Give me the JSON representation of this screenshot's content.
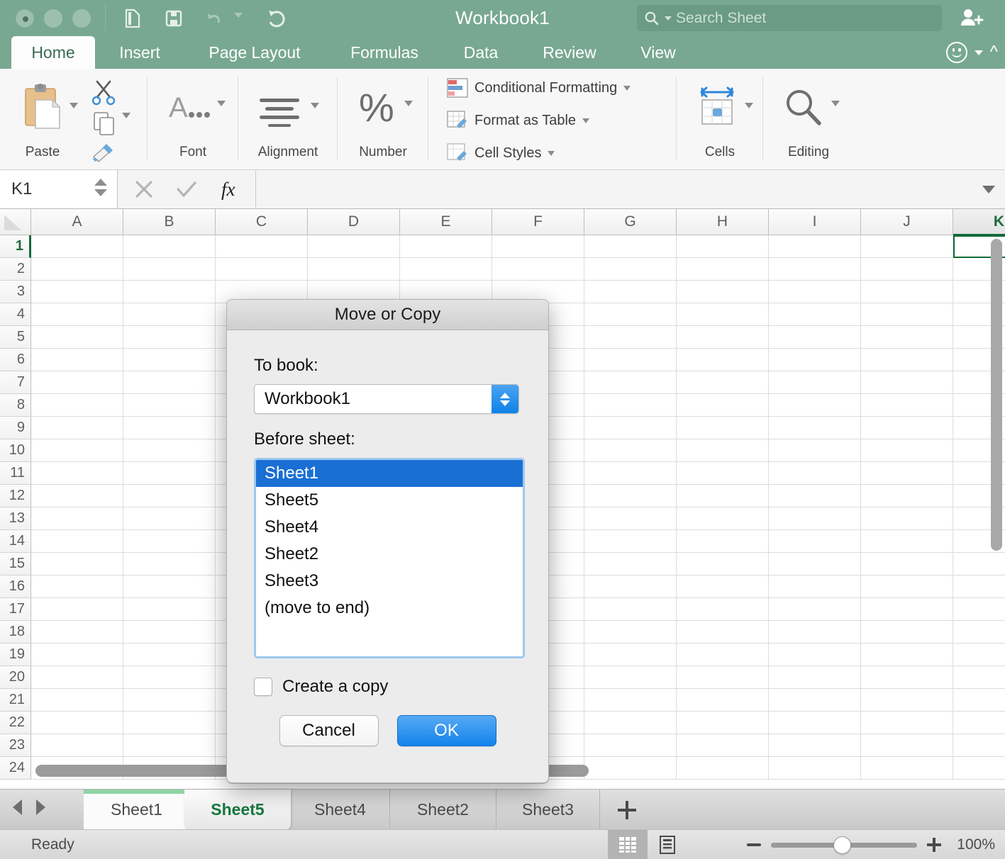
{
  "titlebar": {
    "title": "Workbook1",
    "search_placeholder": "Search Sheet",
    "quick_access": [
      {
        "name": "new-from-template-icon"
      },
      {
        "name": "save-icon"
      },
      {
        "name": "undo-icon"
      },
      {
        "name": "redo-icon"
      }
    ]
  },
  "ribbon_tabs": [
    {
      "label": "Home",
      "active": true
    },
    {
      "label": "Insert",
      "active": false
    },
    {
      "label": "Page Layout",
      "active": false
    },
    {
      "label": "Formulas",
      "active": false
    },
    {
      "label": "Data",
      "active": false
    },
    {
      "label": "Review",
      "active": false
    },
    {
      "label": "View",
      "active": false
    }
  ],
  "ribbon": {
    "groups": [
      {
        "label": "Paste"
      },
      {
        "label": "Font"
      },
      {
        "label": "Alignment"
      },
      {
        "label": "Number"
      },
      {
        "label": "Cells"
      },
      {
        "label": "Editing"
      }
    ],
    "styles_items": [
      {
        "label": "Conditional Formatting"
      },
      {
        "label": "Format as Table"
      },
      {
        "label": "Cell Styles"
      }
    ]
  },
  "formula_bar": {
    "name_box": "K1",
    "formula": ""
  },
  "grid": {
    "columns": [
      "A",
      "B",
      "C",
      "D",
      "E",
      "F",
      "G",
      "H",
      "I",
      "J",
      "K"
    ],
    "selected_column": "K",
    "rows": [
      "1",
      "2",
      "3",
      "4",
      "5",
      "6",
      "7",
      "8",
      "9",
      "10",
      "11",
      "12",
      "13",
      "14",
      "15",
      "16",
      "17",
      "18",
      "19",
      "20",
      "21",
      "22",
      "23",
      "24"
    ],
    "selected_row": "1",
    "active_cell": "K1"
  },
  "dialog": {
    "title": "Move or Copy",
    "to_book_label": "To book:",
    "to_book_value": "Workbook1",
    "before_sheet_label": "Before sheet:",
    "sheet_list": [
      "Sheet1",
      "Sheet5",
      "Sheet4",
      "Sheet2",
      "Sheet3",
      "(move to end)"
    ],
    "selected_index": 0,
    "create_copy_label": "Create a copy",
    "create_copy_checked": false,
    "cancel_label": "Cancel",
    "ok_label": "OK",
    "accent_color": "#1a6fd4"
  },
  "sheet_tabs": {
    "tabs": [
      {
        "label": "Sheet1",
        "state": "previous"
      },
      {
        "label": "Sheet5",
        "state": "active"
      },
      {
        "label": "Sheet4",
        "state": "normal"
      },
      {
        "label": "Sheet2",
        "state": "normal"
      },
      {
        "label": "Sheet3",
        "state": "normal"
      }
    ],
    "add_sheet_label": "+"
  },
  "status_bar": {
    "status": "Ready",
    "zoom_level": "100%"
  }
}
